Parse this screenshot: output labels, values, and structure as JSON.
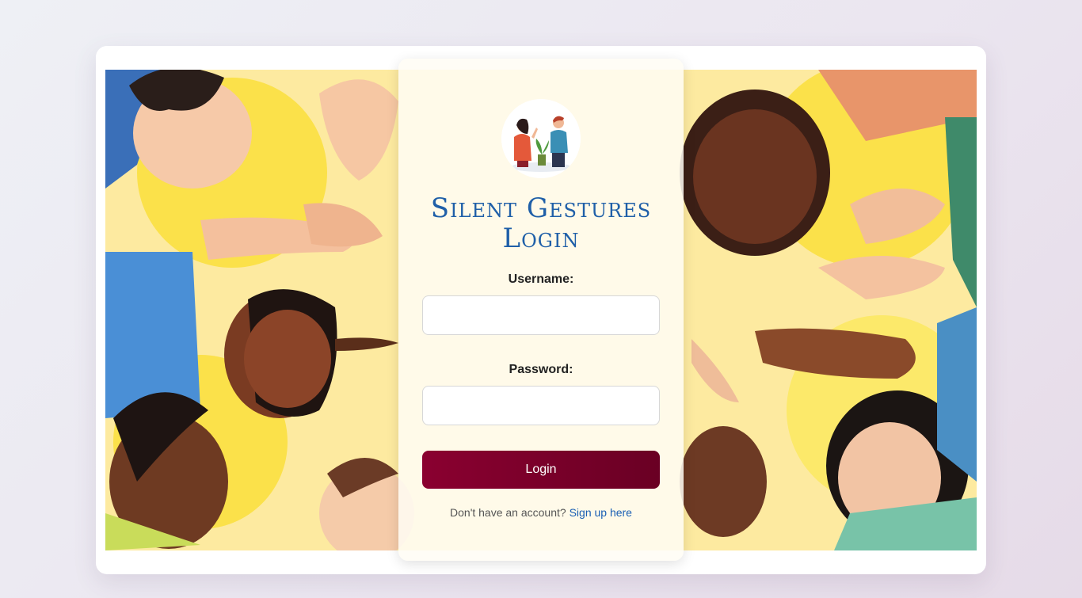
{
  "login": {
    "title_line1": "Silent Gestures",
    "title_line2": "Login",
    "username_label": "Username:",
    "username_value": "",
    "password_label": "Password:",
    "password_value": "",
    "submit_label": "Login",
    "signup_prompt": "Don't have an account?",
    "signup_link": "Sign up here"
  },
  "colors": {
    "title": "#1f5fa8",
    "button": "#7a002a",
    "link": "#1a5fb4"
  },
  "icons": {
    "logo": "two-people-conversation-icon",
    "background": "diverse-people-hands-circle-illustration"
  }
}
